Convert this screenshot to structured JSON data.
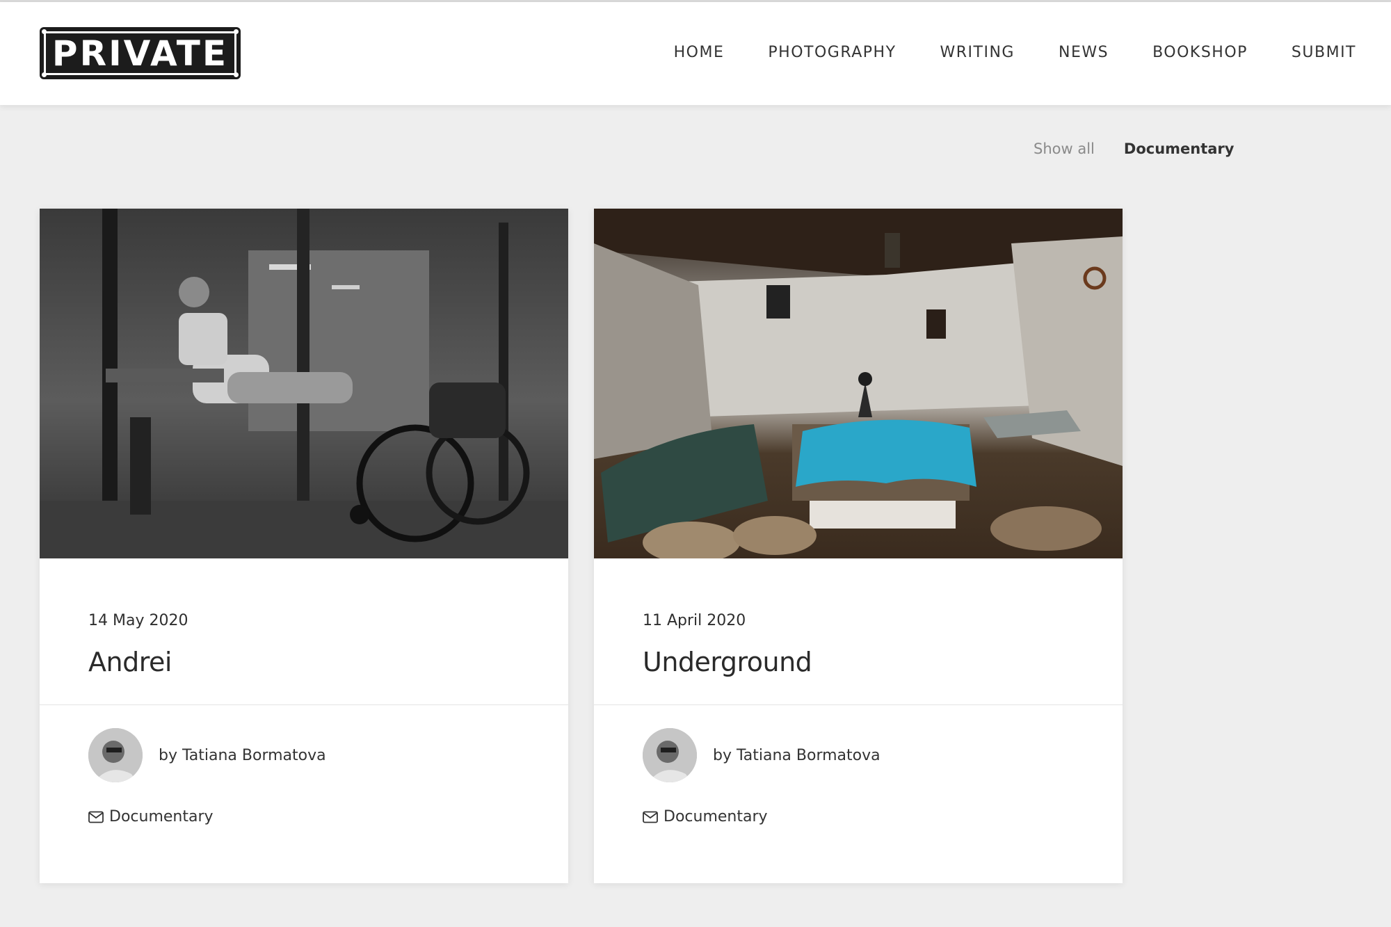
{
  "site": {
    "logo_text": "PRIVATE"
  },
  "nav": {
    "items": [
      {
        "label": "HOME"
      },
      {
        "label": "PHOTOGRAPHY"
      },
      {
        "label": "WRITING"
      },
      {
        "label": "NEWS"
      },
      {
        "label": "BOOKSHOP"
      },
      {
        "label": "SUBMIT"
      }
    ]
  },
  "filters": {
    "show_all": "Show all",
    "active": "Documentary"
  },
  "cards": [
    {
      "date": "14 May 2020",
      "title": "Andrei",
      "author": "by Tatiana Bormatova",
      "category": "Documentary",
      "image_icon": "gym-photo"
    },
    {
      "date": "11 April 2020",
      "title": "Underground",
      "author": "by Tatiana Bormatova",
      "category": "Documentary",
      "image_icon": "cave-photo"
    }
  ]
}
